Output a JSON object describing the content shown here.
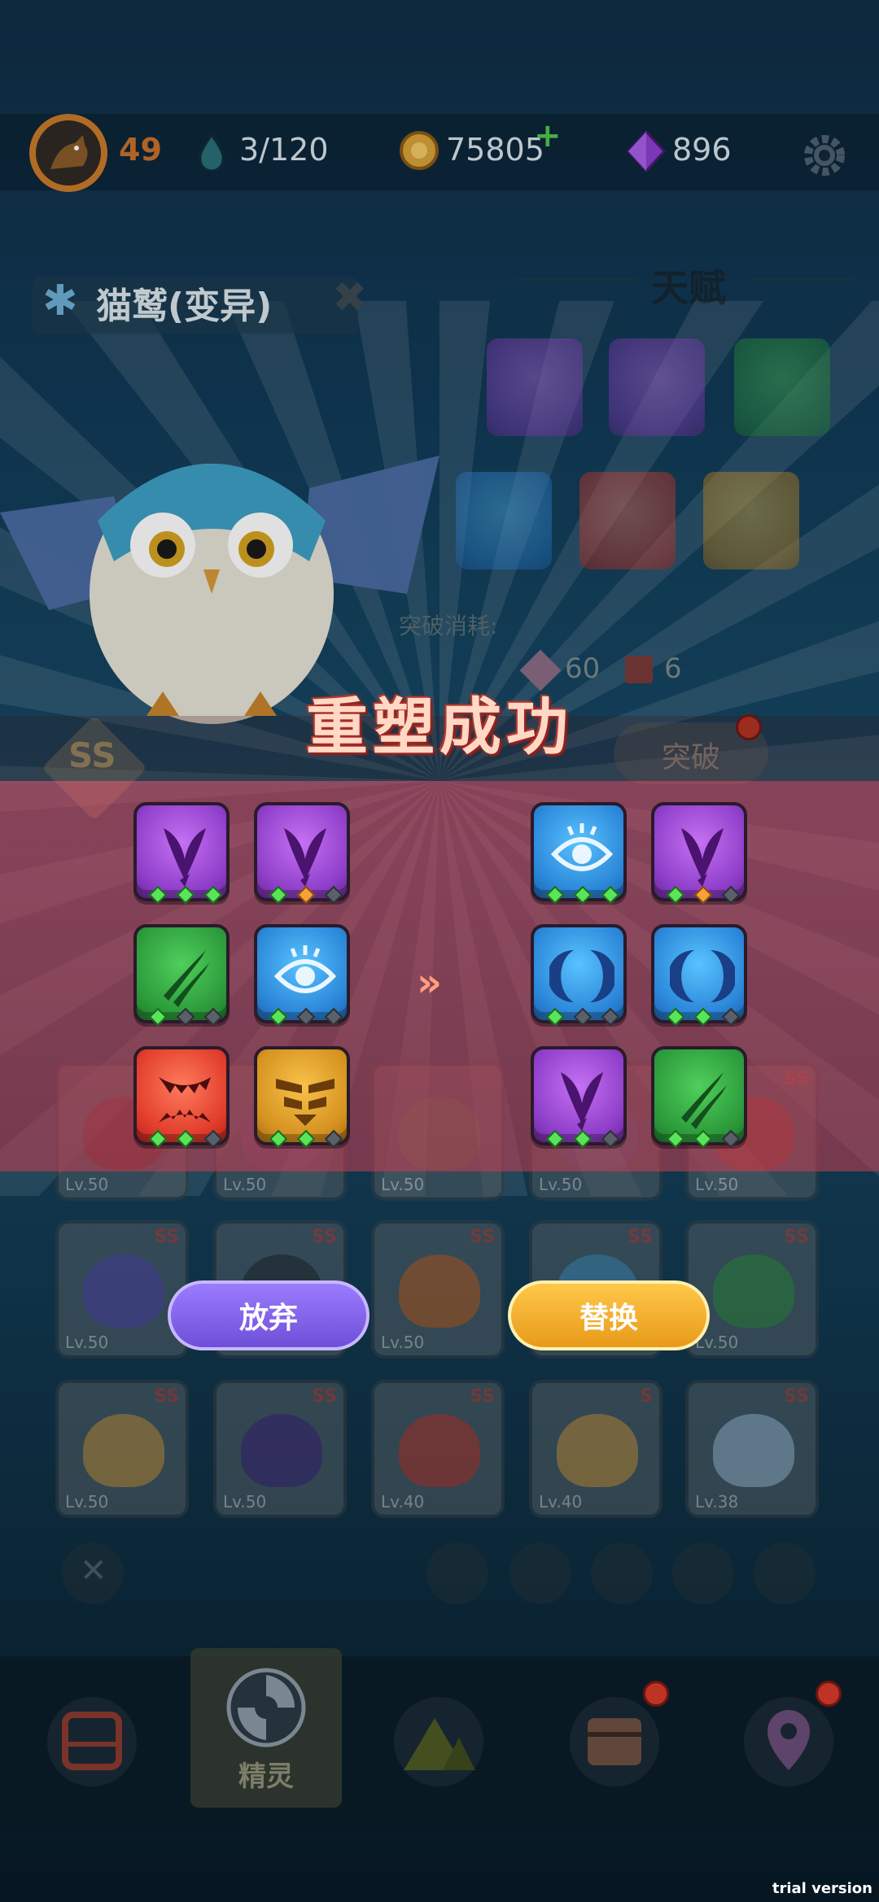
{
  "topbar": {
    "level": "49",
    "stamina": "3/120",
    "coins": "75805",
    "coins_add": "+",
    "gems": "896"
  },
  "pet": {
    "name": "猫鹫(变异)",
    "grade": "SS"
  },
  "talent_panel": {
    "title": "天赋",
    "breakthrough_cost_label": "突破消耗:",
    "cost_gems": "60",
    "cost_books": "6",
    "breakthrough_label": "突破"
  },
  "dialog": {
    "title": "重塑成功",
    "arrow": "»",
    "give_up_label": "放弃",
    "replace_label": "替换",
    "old_talents": [
      {
        "type": "purple",
        "icon": "wing-icon",
        "gems": [
          "green",
          "green",
          "green"
        ]
      },
      {
        "type": "purple",
        "icon": "wing-icon",
        "gems": [
          "green",
          "orange",
          "gray"
        ]
      },
      {
        "type": "green",
        "icon": "claw-icon",
        "gems": [
          "green",
          "gray",
          "gray"
        ]
      },
      {
        "type": "blue",
        "icon": "eye-icon",
        "gems": [
          "green",
          "gray",
          "gray"
        ]
      },
      {
        "type": "red",
        "icon": "fang-icon",
        "gems": [
          "green",
          "green",
          "gray"
        ]
      },
      {
        "type": "gold",
        "icon": "shield-icon",
        "gems": [
          "green",
          "green",
          "gray"
        ]
      }
    ],
    "new_talents": [
      {
        "type": "blue",
        "icon": "eye-icon",
        "gems": [
          "green",
          "green",
          "green"
        ]
      },
      {
        "type": "purple",
        "icon": "wing-icon",
        "gems": [
          "green",
          "orange",
          "gray"
        ]
      },
      {
        "type": "blue",
        "icon": "crescent-icon",
        "gems": [
          "green",
          "gray",
          "gray"
        ]
      },
      {
        "type": "blue",
        "icon": "crescent-icon",
        "gems": [
          "green",
          "green",
          "gray"
        ]
      },
      {
        "type": "purple",
        "icon": "wing-icon",
        "gems": [
          "green",
          "green",
          "gray"
        ]
      },
      {
        "type": "green",
        "icon": "claw-icon",
        "gems": [
          "green",
          "green",
          "gray"
        ]
      }
    ]
  },
  "pets_grid": [
    {
      "lv": "Lv.50",
      "grade": ""
    },
    {
      "lv": "Lv.50",
      "grade": ""
    },
    {
      "lv": "Lv.50",
      "grade": ""
    },
    {
      "lv": "Lv.50",
      "grade": ""
    },
    {
      "lv": "Lv.50",
      "grade": "SS"
    },
    {
      "lv": "Lv.50",
      "grade": "SS"
    },
    {
      "lv": "Lv.50",
      "grade": "SS"
    },
    {
      "lv": "Lv.50",
      "grade": "SS"
    },
    {
      "lv": "Lv.50",
      "grade": "SS"
    },
    {
      "lv": "Lv.50",
      "grade": "SS"
    },
    {
      "lv": "Lv.50",
      "grade": "SS"
    },
    {
      "lv": "Lv.50",
      "grade": "SS"
    },
    {
      "lv": "Lv.40",
      "grade": "SS"
    },
    {
      "lv": "Lv.40",
      "grade": "S"
    },
    {
      "lv": "Lv.38",
      "grade": "SS"
    }
  ],
  "nav": {
    "active_label": "精灵"
  },
  "watermark": "trial version",
  "colors": {
    "purple": "#9b4fd6",
    "green": "#2c9a3b",
    "blue": "#2b86d8",
    "red": "#e13c2b",
    "gold": "#d59220",
    "band": "#d8485a"
  }
}
